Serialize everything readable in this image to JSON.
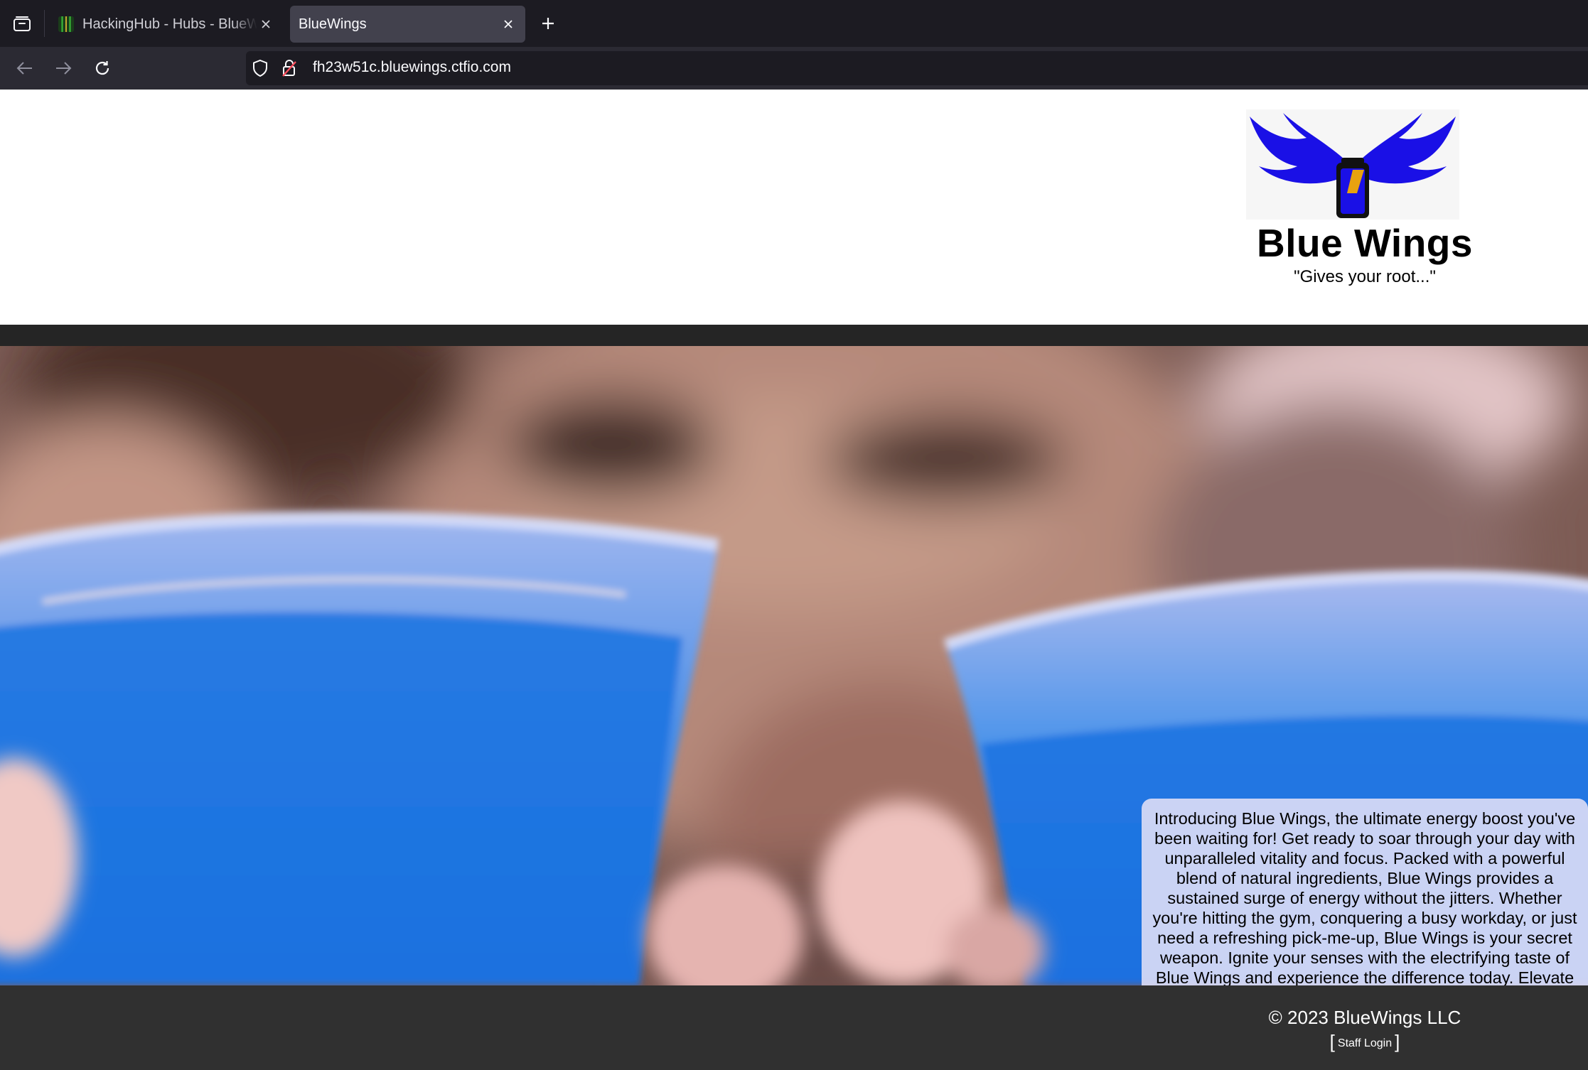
{
  "browser": {
    "tabs": [
      {
        "title": "HackingHub - Hubs - BlueWings",
        "active": false
      },
      {
        "title": "BlueWings",
        "active": true
      }
    ],
    "url": "fh23w51c.bluewings.ctfio.com"
  },
  "header": {
    "brand": "Blue Wings",
    "tagline": "\"Gives your root...\""
  },
  "hero": {
    "promo_text": "Introducing Blue Wings, the ultimate energy boost you've been waiting for! Get ready to soar through your day with unparalleled vitality and focus. Packed with a powerful blend of natural ingredients, Blue Wings provides a sustained surge of energy without the jitters. Whether you're hitting the gym, conquering a busy workday, or just need a refreshing pick-me-up, Blue Wings is your secret weapon. Ignite your senses with the electrifying taste of Blue Wings and experience the difference today. Elevate your energy, embrace the Blue Wings lifestyle!"
  },
  "footer": {
    "copyright": "© 2023 BlueWings LLC",
    "bracket_open": "[",
    "staff_login": "Staff Login",
    "bracket_close": "]"
  },
  "colors": {
    "brand_blue": "#1a10e6",
    "can_yellow": "#e8a20f",
    "footer_bg": "#303030",
    "promo_bg": "#e2e0f6"
  }
}
